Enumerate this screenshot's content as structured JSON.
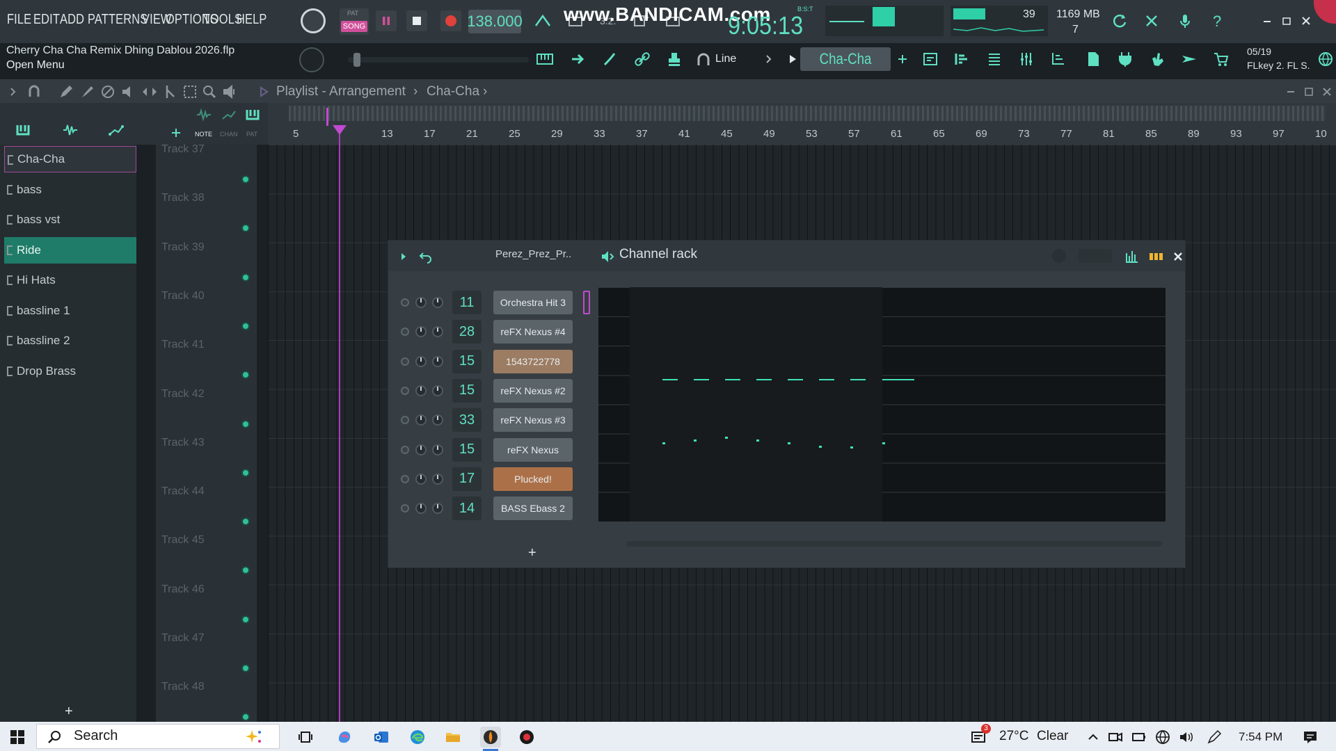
{
  "menu": {
    "items": [
      "FILE",
      "EDIT",
      "ADD",
      "PATTERNS",
      "VIEW",
      "OPTIONS",
      "TOOLS",
      "HELP"
    ],
    "pat_song": [
      "PAT",
      "SONG"
    ]
  },
  "project": {
    "file_name": "Cherry Cha Cha Remix Dhing Dablou 2026.flp",
    "open_menu": "Open Menu"
  },
  "transport": {
    "tempo": "138.000",
    "clock": "9:05:13",
    "clock_sub": "B:S:T",
    "watermark": "www.BANDICAM.com"
  },
  "monitor": {
    "cpu": "39",
    "memory": "1169 MB",
    "polyphony": "7"
  },
  "toolbar": {
    "snap_mode": "Line",
    "pattern": "Cha-Cha",
    "hint_date": "05/19",
    "hint_text": "FLkey 2. FL S."
  },
  "playlist": {
    "title": "Playlist - Arrangement",
    "pattern": "Cha-Cha",
    "mode_labels": [
      "NOTE",
      "CHAN",
      "PAT"
    ],
    "bar_numbers": [
      "5",
      "13",
      "17",
      "21",
      "25",
      "29",
      "33",
      "37",
      "41",
      "45",
      "49",
      "53",
      "57",
      "61",
      "65",
      "69",
      "73",
      "77",
      "81",
      "85",
      "89",
      "93",
      "97",
      "10"
    ],
    "patterns": [
      {
        "name": "Cha-Cha",
        "state": "selected"
      },
      {
        "name": "bass",
        "state": ""
      },
      {
        "name": "bass vst",
        "state": ""
      },
      {
        "name": "Ride",
        "state": "active"
      },
      {
        "name": "Hi Hats",
        "state": ""
      },
      {
        "name": "bassline 1",
        "state": ""
      },
      {
        "name": "bassline 2",
        "state": ""
      },
      {
        "name": "Drop Brass",
        "state": ""
      }
    ],
    "tracks": [
      "Track 37",
      "Track 38",
      "Track 39",
      "Track 40",
      "Track 41",
      "Track 42",
      "Track 43",
      "Track 44",
      "Track 45",
      "Track 46",
      "Track 47",
      "Track 48"
    ]
  },
  "channel_rack": {
    "title": "Channel rack",
    "filter": "Perez_Prez_Pr..",
    "add_label": "+",
    "channels": [
      {
        "num": "11",
        "name": "Orchestra Hit 3",
        "color": "gray"
      },
      {
        "num": "28",
        "name": "reFX Nexus #4",
        "color": "gray"
      },
      {
        "num": "15",
        "name": "1543722778",
        "color": "lightorange"
      },
      {
        "num": "15",
        "name": "reFX Nexus #2",
        "color": "gray"
      },
      {
        "num": "33",
        "name": "reFX Nexus #3",
        "color": "gray"
      },
      {
        "num": "15",
        "name": "reFX Nexus",
        "color": "gray"
      },
      {
        "num": "17",
        "name": "Plucked!",
        "color": "orange"
      },
      {
        "num": "14",
        "name": "BASS Ebass 2",
        "color": "gray"
      }
    ]
  },
  "taskbar": {
    "search": "Search",
    "weather_temp": "27°C",
    "weather_cond": "Clear",
    "time": "7:54 PM",
    "notification_count": "3"
  },
  "colors": {
    "accent": "#5fe0c2",
    "active_pattern": "#1e7c68",
    "playhead": "#b237c0",
    "record": "#e0413a"
  }
}
